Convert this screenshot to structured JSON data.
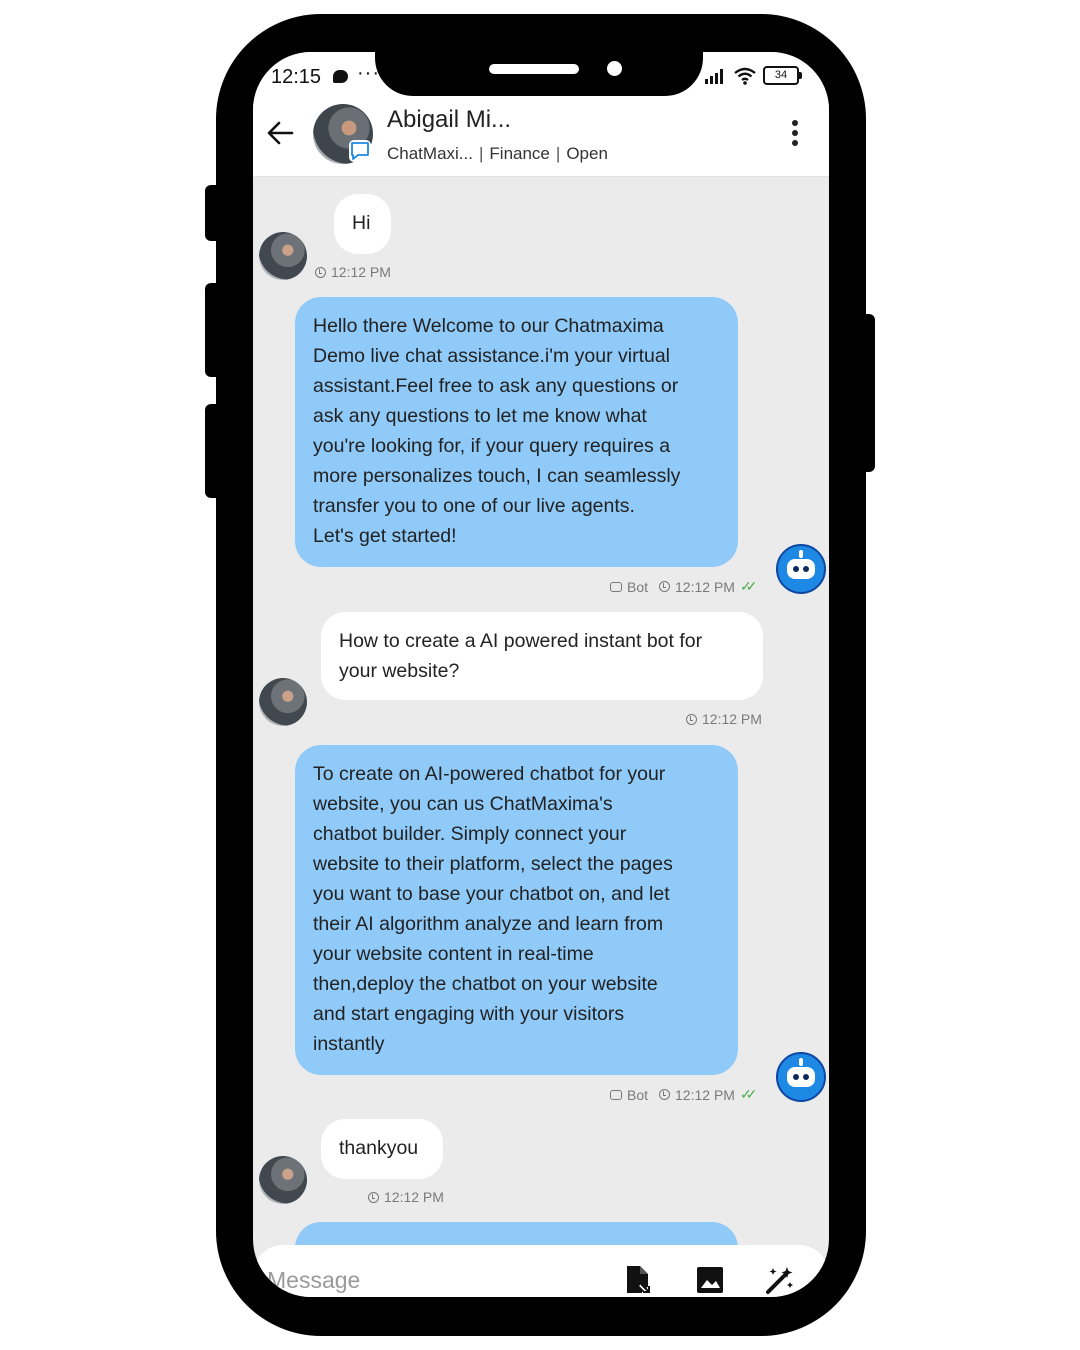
{
  "status_bar": {
    "time": "12:15",
    "dots": "···",
    "battery": "34"
  },
  "header": {
    "name": "Abigail Mi...",
    "channel": "ChatMaxi...",
    "department": "Finance",
    "status": "Open",
    "separator": "|"
  },
  "messages": [
    {
      "side": "in",
      "text": "Hi",
      "time": "12:12 PM"
    },
    {
      "side": "out",
      "text": "Hello there Welcome to our Chatmaxima\nDemo live chat assistance.i'm your virtual\nassistant.Feel free to ask any questions or\nask any questions to let me know what\nyou're looking for, if your query requires a\nmore personalizes touch, I can seamlessly\ntransfer you to one of our live agents.\nLet's get started!",
      "sender": "Bot",
      "time": "12:12 PM"
    },
    {
      "side": "in",
      "text": "How to create a AI powered instant bot for\nyour website?",
      "time": "12:12 PM"
    },
    {
      "side": "out",
      "text": "To create on AI-powered chatbot for your\nwebsite, you can us ChatMaxima's\nchatbot builder. Simply connect your\nwebsite to their platform, select the pages\nyou want to base your chatbot on, and let\ntheir AI algorithm analyze and learn from\nyour website content in real-time\nthen,deploy the chatbot on your website\nand start engaging with your visitors\ninstantly",
      "sender": "Bot",
      "time": "12:12 PM"
    },
    {
      "side": "in",
      "text": "thankyou",
      "time": "12:12 PM"
    }
  ],
  "composer": {
    "placeholder": "Message"
  },
  "icons": [
    "back-arrow-icon",
    "whatsapp-chat-icon",
    "more-vert-icon",
    "clock-icon",
    "bot-icon",
    "double-check-icon",
    "attach-file-icon",
    "image-icon",
    "magic-wand-icon"
  ],
  "colors": {
    "outgoing_bubble": "#90caf9",
    "incoming_bubble": "#ffffff",
    "chat_bg": "#ebebeb",
    "bot_avatar": "#1e88e5",
    "read_ticks": "#4caf50"
  }
}
